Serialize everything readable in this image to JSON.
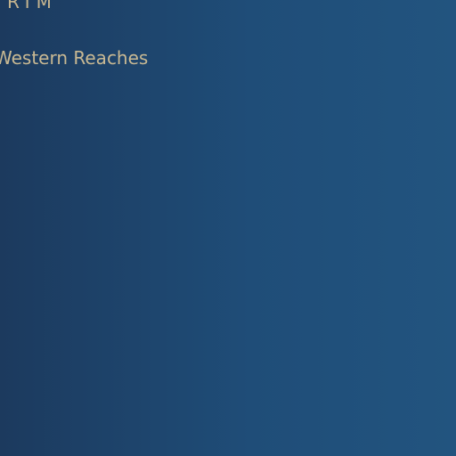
{
  "header": {
    "brand_text": "RTM",
    "region_label": "Western Reaches"
  },
  "theme": {
    "background_start": "#1c3a5e",
    "background_end": "#22547f",
    "text_color": "#c9b993"
  }
}
